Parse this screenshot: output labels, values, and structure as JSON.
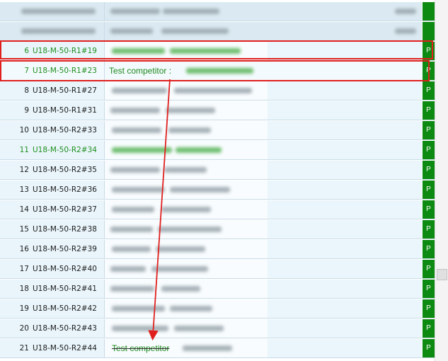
{
  "rows": [
    {
      "num": "",
      "code": "",
      "header": true
    },
    {
      "num": "",
      "code": "",
      "header": true
    },
    {
      "num": "6",
      "code": "U18-M-50-R1#19",
      "green": true,
      "status": "P"
    },
    {
      "num": "7",
      "code": "U18-M-50-R1#23",
      "green": true,
      "highlight": true,
      "name": "Test competitor :",
      "status": "P"
    },
    {
      "num": "8",
      "code": "U18-M-50-R1#27",
      "status": "P"
    },
    {
      "num": "9",
      "code": "U18-M-50-R1#31",
      "status": "P"
    },
    {
      "num": "10",
      "code": "U18-M-50-R2#33",
      "status": "P"
    },
    {
      "num": "11",
      "code": "U18-M-50-R2#34",
      "green": true,
      "status": "P"
    },
    {
      "num": "12",
      "code": "U18-M-50-R2#35",
      "status": "P"
    },
    {
      "num": "13",
      "code": "U18-M-50-R2#36",
      "status": "P"
    },
    {
      "num": "14",
      "code": "U18-M-50-R2#37",
      "status": "P"
    },
    {
      "num": "15",
      "code": "U18-M-50-R2#38",
      "status": "P"
    },
    {
      "num": "16",
      "code": "U18-M-50-R2#39",
      "status": "P"
    },
    {
      "num": "17",
      "code": "U18-M-50-R2#40",
      "status": "P"
    },
    {
      "num": "18",
      "code": "U18-M-50-R2#41",
      "status": "P"
    },
    {
      "num": "19",
      "code": "U18-M-50-R2#42",
      "status": "P"
    },
    {
      "num": "20",
      "code": "U18-M-50-R2#43",
      "status": "P"
    },
    {
      "num": "21",
      "code": "U18-M-50-R2#44",
      "strike_name": "Test competitor",
      "status": "P"
    }
  ],
  "colors": {
    "green": "#1f8f1f",
    "status_bg": "#0d8a12",
    "annotation": "#e0201e"
  }
}
